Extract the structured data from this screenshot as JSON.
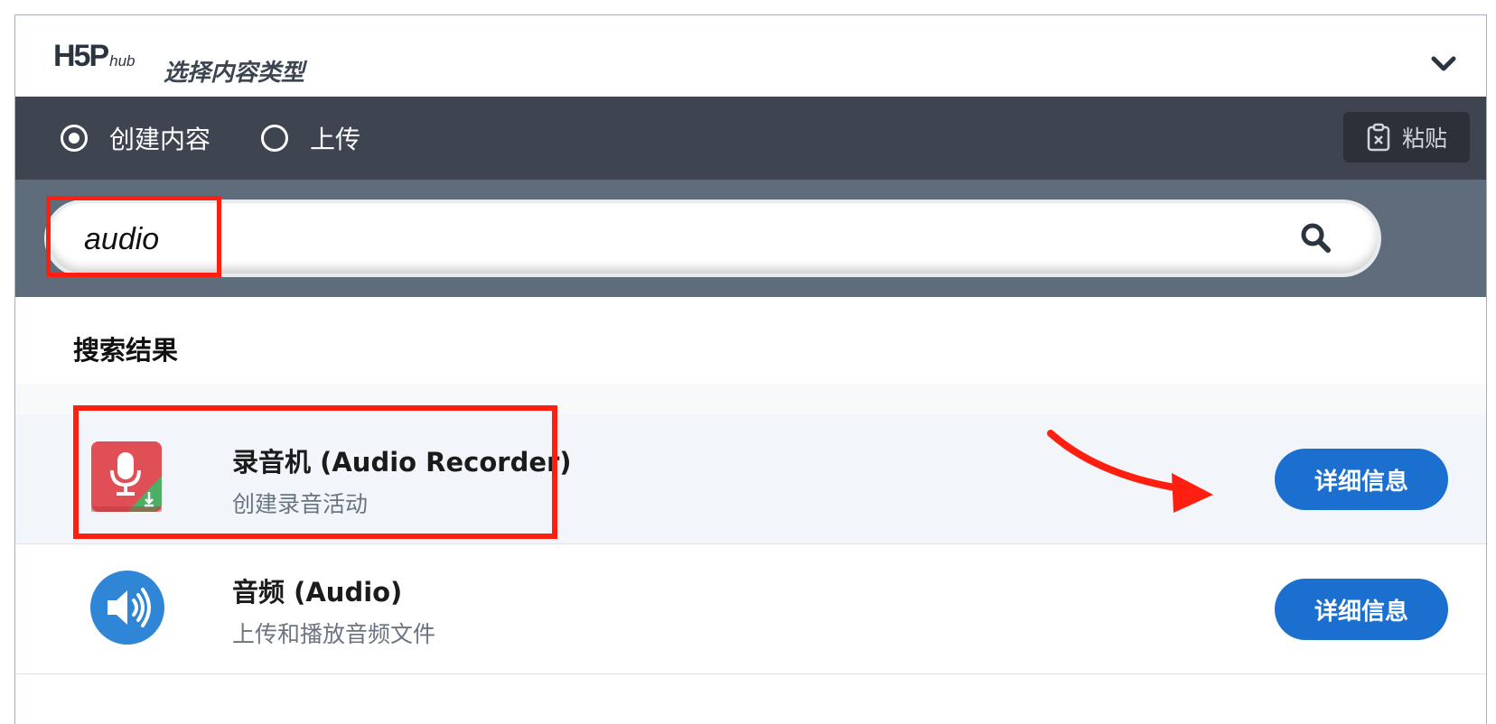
{
  "header": {
    "logo_main": "H5P",
    "logo_sub": "hub",
    "title": "选择内容类型"
  },
  "tabs": [
    {
      "label": "创建内容",
      "selected": true
    },
    {
      "label": "上传",
      "selected": false
    }
  ],
  "toolbar": {
    "paste_label": "粘贴"
  },
  "search": {
    "value": "audio"
  },
  "results": {
    "heading": "搜索结果",
    "items": [
      {
        "title": "录音机 (Audio Recorder)",
        "description": "创建录音活动",
        "details_label": "详细信息",
        "icon": "microphone-icon",
        "icon_color": "#e04f55"
      },
      {
        "title": "音频 (Audio)",
        "description": "上传和播放音频文件",
        "details_label": "详细信息",
        "icon": "speaker-icon",
        "icon_color": "#2f86d6"
      }
    ]
  },
  "colors": {
    "tab_bar": "#3e4550",
    "search_band": "#5e6c7c",
    "button_blue": "#1a6fcf",
    "annotation_red": "#ff1f10"
  }
}
